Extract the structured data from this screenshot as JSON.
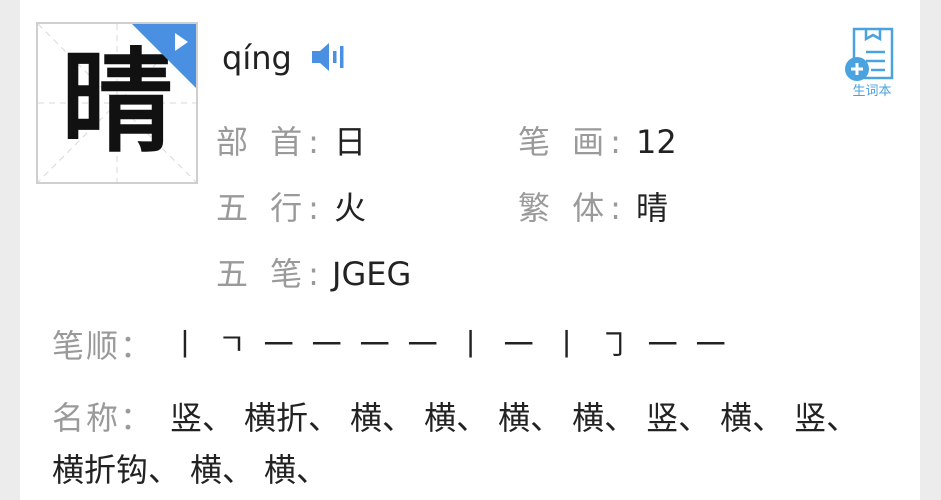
{
  "character": {
    "glyph": "晴",
    "pinyin": "qíng"
  },
  "info": {
    "radical_label": "部 首:",
    "radical_value": "日",
    "strokes_label": "笔 画:",
    "strokes_value": "12",
    "wuxing_label": "五 行:",
    "wuxing_value": "火",
    "traditional_label": "繁 体:",
    "traditional_value": "晴",
    "wubi_label": "五 笔:",
    "wubi_value": "JGEG"
  },
  "vocab_button": {
    "label": "生词本"
  },
  "stroke_order": {
    "label": "笔顺：",
    "strokes": [
      "丨",
      "ㄱ",
      "一",
      "一",
      "一",
      "一",
      "丨",
      "一",
      "丨",
      "㇆",
      "一",
      "一"
    ]
  },
  "stroke_names": {
    "label": "名称：",
    "names": [
      "竖、",
      "横折、",
      "横、",
      "横、",
      "横、",
      "横、",
      "竖、",
      "横、",
      "竖、",
      "横折钩、",
      "横、",
      "横、"
    ]
  },
  "colors": {
    "accent": "#4a90e2",
    "label_gray": "#9a9a9a",
    "vocab_blue": "#4aa3df"
  }
}
